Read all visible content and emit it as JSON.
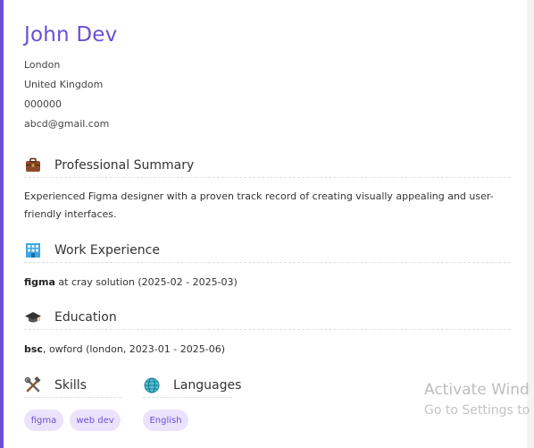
{
  "profile": {
    "name": "John Dev",
    "city": "London",
    "country": "United Kingdom",
    "phone": "000000",
    "email": "abcd@gmail.com"
  },
  "summary": {
    "heading": "Professional Summary",
    "icon": "briefcase-icon",
    "text": "Experienced Figma designer with a proven track record of creating visually appealing and user-friendly interfaces."
  },
  "work": {
    "heading": "Work Experience",
    "icon": "building-icon",
    "entry": {
      "role": "figma",
      "connector": " at ",
      "company": "cray solution",
      "dates": " (2025-02 - 2025-03)"
    }
  },
  "education": {
    "heading": "Education",
    "icon": "graduation-cap-icon",
    "entry": {
      "degree": "bsc",
      "rest": ", owford (london, 2023-01 - 2025-06)"
    }
  },
  "skills": {
    "heading": "Skills",
    "icon": "tools-icon",
    "items": [
      "figma",
      "web dev"
    ]
  },
  "languages": {
    "heading": "Languages",
    "icon": "globe-icon",
    "items": [
      "English"
    ]
  },
  "watermark": {
    "line1": "Activate Wind",
    "line2": "Go to Settings to a"
  },
  "colors": {
    "accent": "#6a4fd3",
    "pill_bg": "#ebe3fb"
  }
}
